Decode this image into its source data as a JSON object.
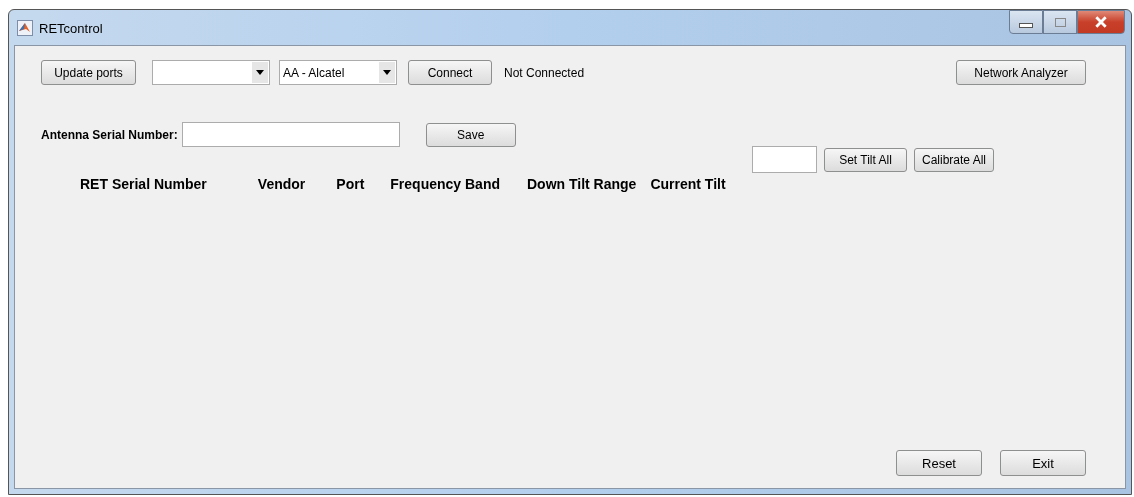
{
  "window": {
    "title": "RETcontrol"
  },
  "toolbar": {
    "update_ports": "Update ports",
    "vendor_dropdown": {
      "value": "AA - Alcatel"
    },
    "connect": "Connect",
    "status": "Not Connected",
    "network_analyzer": "Network Analyzer"
  },
  "antenna": {
    "label": "Antenna Serial Number:",
    "save": "Save"
  },
  "tilt": {
    "set_tilt_all": "Set Tilt All",
    "calibrate_all": "Calibrate All"
  },
  "table": {
    "columns": [
      "RET Serial Number",
      "Vendor",
      "Port",
      "Frequency Band",
      "Down Tilt Range",
      "Current Tilt"
    ]
  },
  "footer": {
    "buttons": [
      "Reset",
      "Exit"
    ]
  }
}
